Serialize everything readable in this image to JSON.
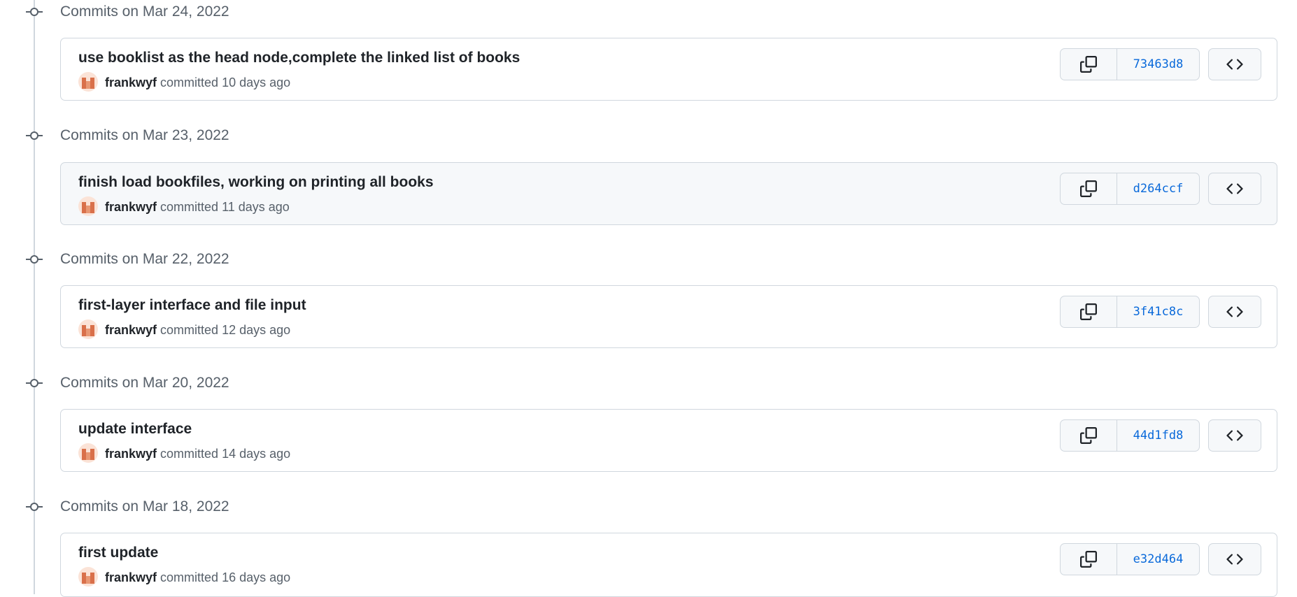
{
  "groups": [
    {
      "date": "Commits on Mar 24, 2022",
      "commit": {
        "title": "use booklist as the head node,complete the linked list of books",
        "author": "frankwyf",
        "committed": "committed",
        "time": "10 days ago",
        "sha": "73463d8"
      }
    },
    {
      "date": "Commits on Mar 23, 2022",
      "commit": {
        "title": "finish load bookfiles, working on printing all books",
        "author": "frankwyf",
        "committed": "committed",
        "time": "11 days ago",
        "sha": "d264ccf"
      }
    },
    {
      "date": "Commits on Mar 22, 2022",
      "commit": {
        "title": "first-layer interface and file input",
        "author": "frankwyf",
        "committed": "committed",
        "time": "12 days ago",
        "sha": "3f41c8c"
      }
    },
    {
      "date": "Commits on Mar 20, 2022",
      "commit": {
        "title": "update interface",
        "author": "frankwyf",
        "committed": "committed",
        "time": "14 days ago",
        "sha": "44d1fd8"
      }
    },
    {
      "date": "Commits on Mar 18, 2022",
      "commit": {
        "title": "first update",
        "author": "frankwyf",
        "committed": "committed",
        "time": "16 days ago",
        "sha": "e32d464"
      }
    }
  ],
  "icons": {
    "timeline": "git-commit-icon",
    "copy": "copy-icon",
    "browse": "code-icon",
    "avatar": "identicon-avatar"
  },
  "colors": {
    "link": "#0969da",
    "muted": "#57606a",
    "border": "#d0d7de",
    "button_bg": "#f6f8fa",
    "avatar": "#d9704a"
  }
}
